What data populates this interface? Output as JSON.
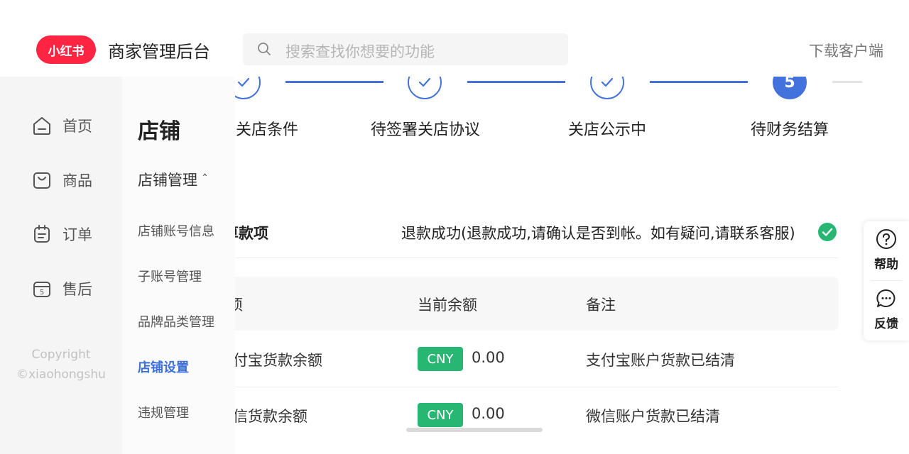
{
  "header": {
    "logo_text": "小红书",
    "app_title": "商家管理后台",
    "search_placeholder": "搜索查找你想要的功能",
    "download_label": "下载客户端"
  },
  "primary_nav": {
    "items": [
      {
        "label": "首页",
        "icon": "home-icon"
      },
      {
        "label": "商品",
        "icon": "bag-icon"
      },
      {
        "label": "订单",
        "icon": "order-icon"
      },
      {
        "label": "售后",
        "icon": "after-sales-icon"
      }
    ],
    "copyright_line1": "Copyright",
    "copyright_line2": "©xiaohongshu"
  },
  "secondary_nav": {
    "title": "店铺",
    "group_label": "店铺管理",
    "group_chevron": "ˆ",
    "items": [
      {
        "label": "店铺账号信息",
        "active": false
      },
      {
        "label": "子账号管理",
        "active": false
      },
      {
        "label": "品牌品类管理",
        "active": false
      },
      {
        "label": "店铺设置",
        "active": true
      },
      {
        "label": "违规管理",
        "active": false
      }
    ]
  },
  "stepper": {
    "steps": [
      {
        "label": "关店条件",
        "status": "done"
      },
      {
        "label": "待签署关店协议",
        "status": "done"
      },
      {
        "label": "关店公示中",
        "status": "done"
      },
      {
        "label": "待财务结算",
        "status": "current",
        "number": "5"
      }
    ]
  },
  "refund": {
    "label": "算款项",
    "status_text": "退款成功(退款成功,请确认是否到帐。如有疑问,请联系客服)"
  },
  "table": {
    "headers": [
      "项",
      "当前余额",
      "备注"
    ],
    "rows": [
      {
        "item": "付宝货款余额",
        "currency": "CNY",
        "amount": "0.00",
        "note": "支付宝账户货款已结清"
      },
      {
        "item": "信货款余额",
        "currency": "CNY",
        "amount": "0.00",
        "note": "微信账户货款已结清"
      }
    ]
  },
  "float_panel": {
    "help_label": "帮助",
    "feedback_label": "反馈"
  },
  "colors": {
    "brand": "#ff2442",
    "primary": "#4472dc",
    "success": "#27b772"
  }
}
